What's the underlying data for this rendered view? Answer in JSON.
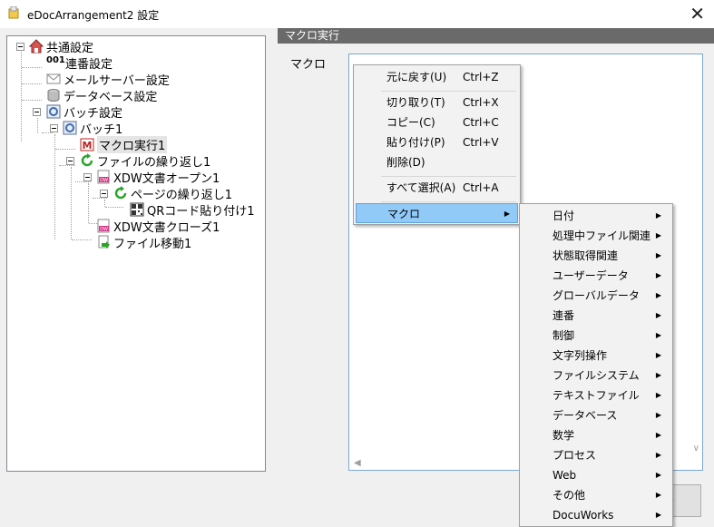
{
  "window": {
    "title": "eDocArrangement2 設定",
    "close_glyph": "✕"
  },
  "tree": {
    "items": [
      {
        "label": "共通設定",
        "icon": "house-icon"
      },
      {
        "label": "連番設定",
        "icon": "counter-icon",
        "badge": "001"
      },
      {
        "label": "メールサーバー設定",
        "icon": "mail-icon"
      },
      {
        "label": "データベース設定",
        "icon": "database-icon"
      },
      {
        "label": "バッチ設定",
        "icon": "batch-icon"
      },
      {
        "label": "バッチ1",
        "icon": "batch-icon"
      },
      {
        "label": "マクロ実行1",
        "icon": "macro-icon"
      },
      {
        "label": "ファイルの繰り返し1",
        "icon": "loop-icon"
      },
      {
        "label": "XDW文書オープン1",
        "icon": "docuworks-icon"
      },
      {
        "label": "ページの繰り返し1",
        "icon": "loop-icon"
      },
      {
        "label": "QRコード貼り付け1",
        "icon": "qr-code-icon"
      },
      {
        "label": "XDW文書クローズ1",
        "icon": "docuworks-icon"
      },
      {
        "label": "ファイル移動1",
        "icon": "file-move-icon"
      }
    ]
  },
  "panel": {
    "header": "マクロ実行",
    "macro_label": "マクロ"
  },
  "context_menu": {
    "items": [
      {
        "label": "元に戻す(U)",
        "shortcut": "Ctrl+Z"
      },
      {
        "label": "切り取り(T)",
        "shortcut": "Ctrl+X"
      },
      {
        "label": "コピー(C)",
        "shortcut": "Ctrl+C"
      },
      {
        "label": "貼り付け(P)",
        "shortcut": "Ctrl+V"
      },
      {
        "label": "削除(D)",
        "shortcut": ""
      },
      {
        "label": "すべて選択(A)",
        "shortcut": "Ctrl+A"
      },
      {
        "label": "マクロ",
        "shortcut": ""
      }
    ]
  },
  "submenu": {
    "items": [
      "日付",
      "処理中ファイル関連",
      "状態取得関連",
      "ユーザーデータ",
      "グローバルデータ",
      "連番",
      "制御",
      "文字列操作",
      "ファイルシステム",
      "テキストファイル",
      "データベース",
      "数学",
      "プロセス",
      "Web",
      "その他",
      "DocuWorks"
    ]
  },
  "buttons": {
    "cancel_partial": "ル"
  },
  "colors": {
    "highlight": "#91c9f7",
    "header_bg": "#6a6a6a",
    "focus_border": "#7aa7d6"
  }
}
